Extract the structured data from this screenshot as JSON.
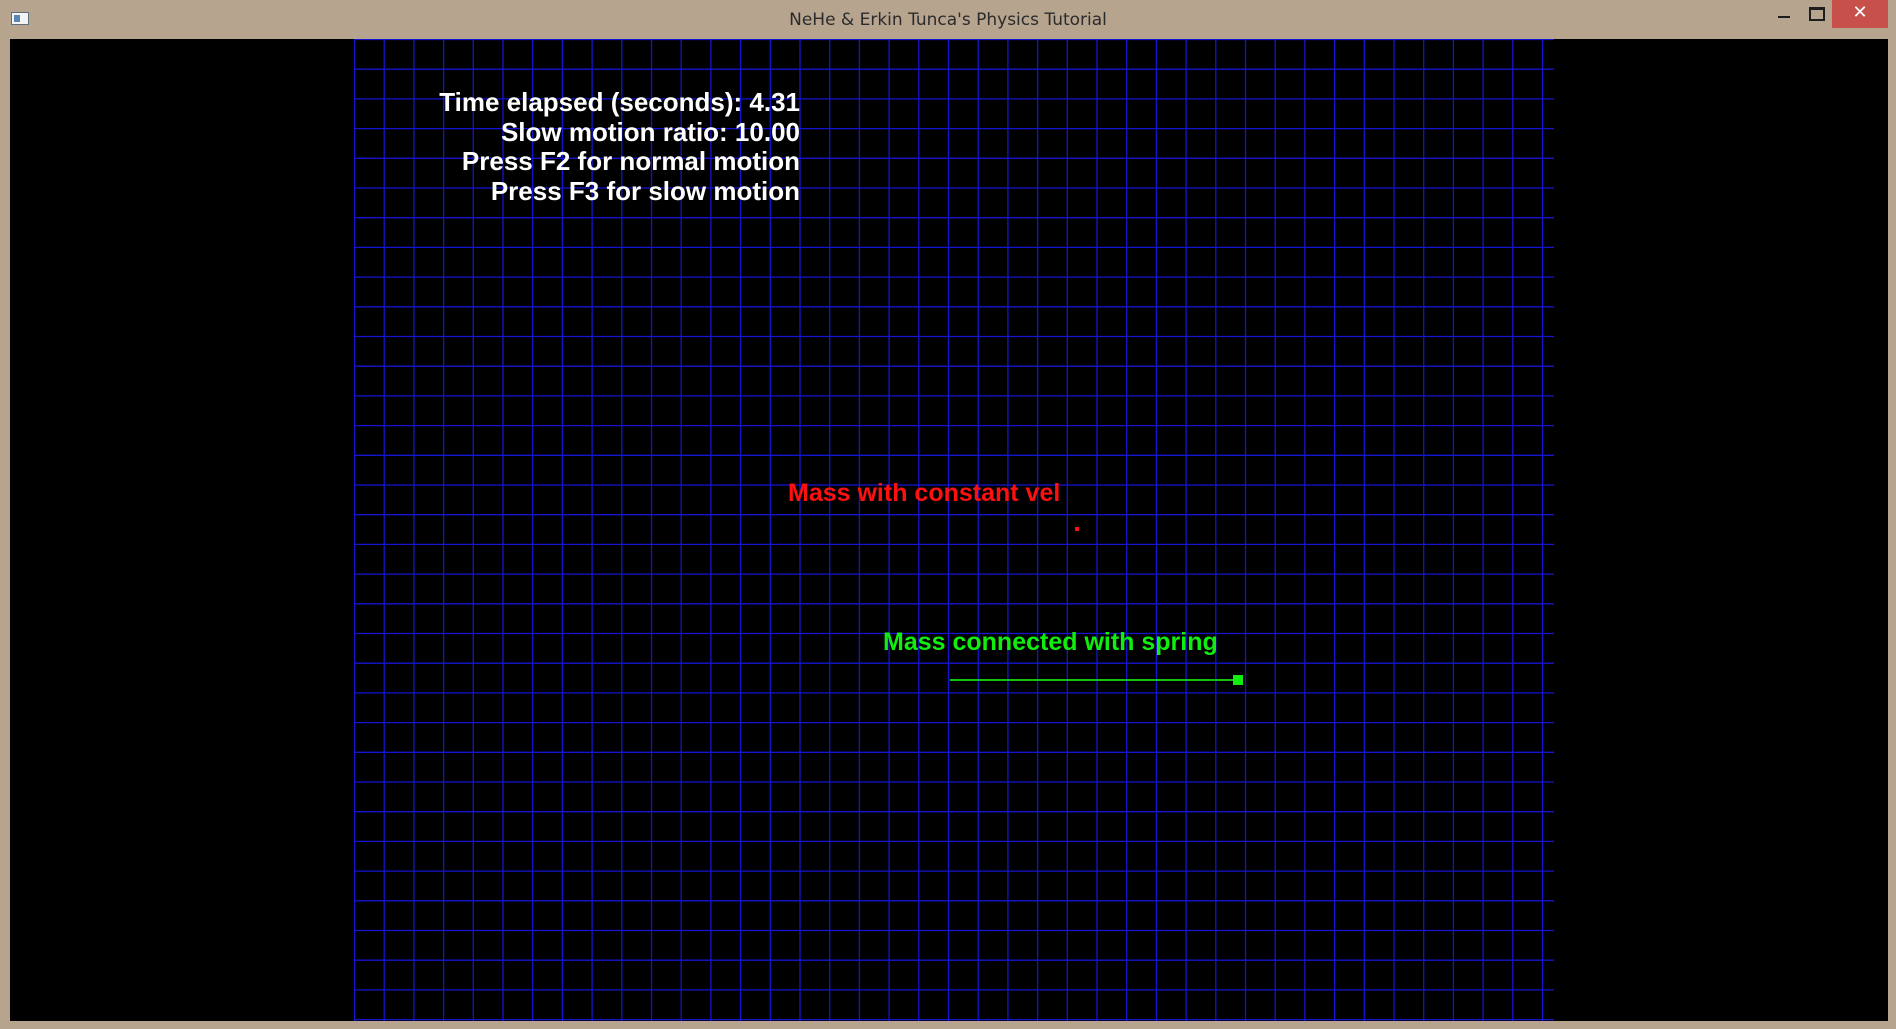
{
  "window": {
    "title": "NeHe & Erkin Tunca's Physics Tutorial",
    "close_glyph": "✕"
  },
  "hud": {
    "time_elapsed": "Time elapsed (seconds): 4.31",
    "slow_motion_ratio": "Slow motion ratio: 10.00",
    "normal_motion_hint": "Press F2 for normal motion",
    "slow_motion_hint": "Press F3 for slow motion"
  },
  "scene": {
    "constant_vel_label": "Mass with constant vel",
    "spring_label": "Mass connected with spring",
    "colors": {
      "grid": "#1414d2",
      "constant_vel": "#ff1010",
      "spring": "#10ee10",
      "hud_text": "#ffffff",
      "background": "#000000"
    }
  }
}
